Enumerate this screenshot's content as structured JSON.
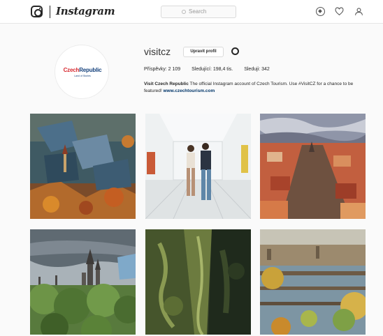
{
  "topbar": {
    "logo_text": "Instagram",
    "search_placeholder": "Search"
  },
  "profile": {
    "username": "visitcz",
    "edit_button": "Upravit profil",
    "stats": {
      "posts": "Příspěvky: 2 109",
      "followers": "Sledující: 198,4 tis.",
      "following": "Sleduji: 342"
    },
    "bio_name": "Visit Czech Republic",
    "bio_text": " The official Instagram account of Czech Tourism. Use #VisitCZ for a chance to be featured!",
    "bio_link": "www.czechtourism.com",
    "avatar_brand_1": "Czech",
    "avatar_brand_2": "Republic",
    "avatar_brand_sub": "Land of Stories"
  },
  "posts": [
    {
      "subject": "aerial-town-autumn"
    },
    {
      "subject": "couple-white-corridor"
    },
    {
      "subject": "prague-rooftops"
    },
    {
      "subject": "castle-forest"
    },
    {
      "subject": "mossy-gorge"
    },
    {
      "subject": "prague-bridges"
    }
  ],
  "colors": {
    "brand_red": "#d7282f",
    "brand_blue": "#13407c",
    "link": "#003569"
  }
}
